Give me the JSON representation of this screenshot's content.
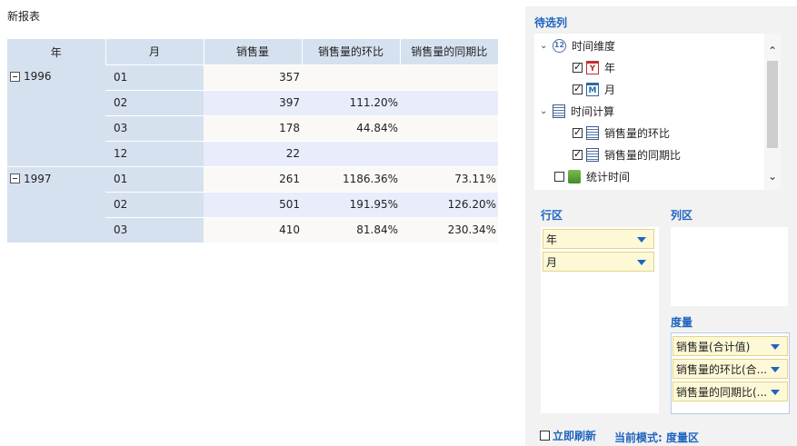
{
  "report": {
    "title": "新报表",
    "columns": [
      "年",
      "月",
      "销售量",
      "销售量的环比",
      "销售量的同期比"
    ],
    "groups": [
      {
        "year": "1996",
        "rows": [
          {
            "month": "01",
            "sales": "357",
            "mom": "",
            "yoy": ""
          },
          {
            "month": "02",
            "sales": "397",
            "mom": "111.20%",
            "yoy": ""
          },
          {
            "month": "03",
            "sales": "178",
            "mom": "44.84%",
            "yoy": ""
          },
          {
            "month": "12",
            "sales": "22",
            "mom": "",
            "yoy": ""
          }
        ]
      },
      {
        "year": "1997",
        "rows": [
          {
            "month": "01",
            "sales": "261",
            "mom": "1186.36%",
            "yoy": "73.11%"
          },
          {
            "month": "02",
            "sales": "501",
            "mom": "191.95%",
            "yoy": "126.20%"
          },
          {
            "month": "03",
            "sales": "410",
            "mom": "81.84%",
            "yoy": "230.34%"
          }
        ]
      }
    ]
  },
  "panel": {
    "candidates_title": "待选列",
    "tree": {
      "time_dim": "时间维度",
      "year": "年",
      "month": "月",
      "time_calc": "时间计算",
      "mom": "销售量的环比",
      "yoy": "销售量的同期比",
      "stat_time": "统计时间"
    },
    "row_zone_title": "行区",
    "col_zone_title": "列区",
    "measure_title": "度量",
    "row_fields": [
      "年",
      "月"
    ],
    "measures": [
      "销售量(合计值)",
      "销售量的环比(合...",
      "销售量的同期比(..."
    ],
    "refresh_label": "立即刷新",
    "mode_label": "当前模式: 度量区"
  },
  "colors": {
    "accent": "#1f64c0",
    "header_bg": "#d6e1f0",
    "pill_bg": "#fdf8d6"
  }
}
